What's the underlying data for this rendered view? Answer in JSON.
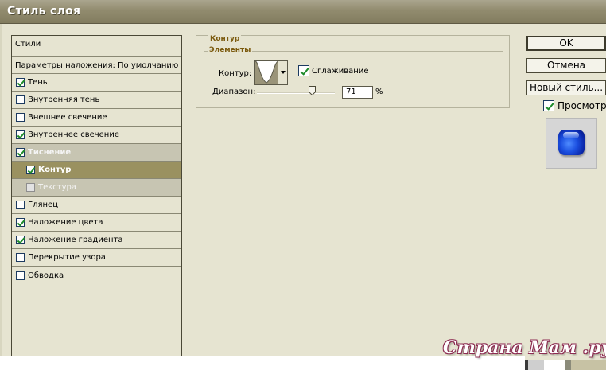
{
  "window": {
    "title": "Стиль слоя"
  },
  "styles_panel": {
    "header": "Стили",
    "blend_options": "Параметры наложения: По умолчанию",
    "items": [
      {
        "label": "Тень",
        "checked": true
      },
      {
        "label": "Внутренняя тень",
        "checked": false
      },
      {
        "label": "Внешнее свечение",
        "checked": false
      },
      {
        "label": "Внутреннее свечение",
        "checked": true
      },
      {
        "label": "Тиснение",
        "checked": true
      },
      {
        "label": "Контур",
        "checked": true
      },
      {
        "label": "Текстура",
        "checked": false
      },
      {
        "label": "Глянец",
        "checked": false
      },
      {
        "label": "Наложение цвета",
        "checked": true
      },
      {
        "label": "Наложение градиента",
        "checked": true
      },
      {
        "label": "Перекрытие узора",
        "checked": false
      },
      {
        "label": "Обводка",
        "checked": false
      }
    ]
  },
  "contour_section": {
    "title": "Контур",
    "group_title": "Элементы",
    "contour_label": "Контур:",
    "antialias_label": "Сглаживание",
    "antialias_checked": true,
    "range_label": "Диапазон:",
    "range_value": "71",
    "range_unit": "%",
    "range_fraction": 0.71
  },
  "buttons": {
    "ok": "OK",
    "cancel": "Отмена",
    "new_style": "Новый стиль..."
  },
  "preview": {
    "label": "Просмотр",
    "checked": true
  },
  "watermark": "Страна Мам .ру",
  "colors": {
    "dialog_bg": "#e6e4d1",
    "selected_row": "#9a9160",
    "section_title": "#7b5a0e",
    "preview_swatch": "#1b4fe0"
  }
}
